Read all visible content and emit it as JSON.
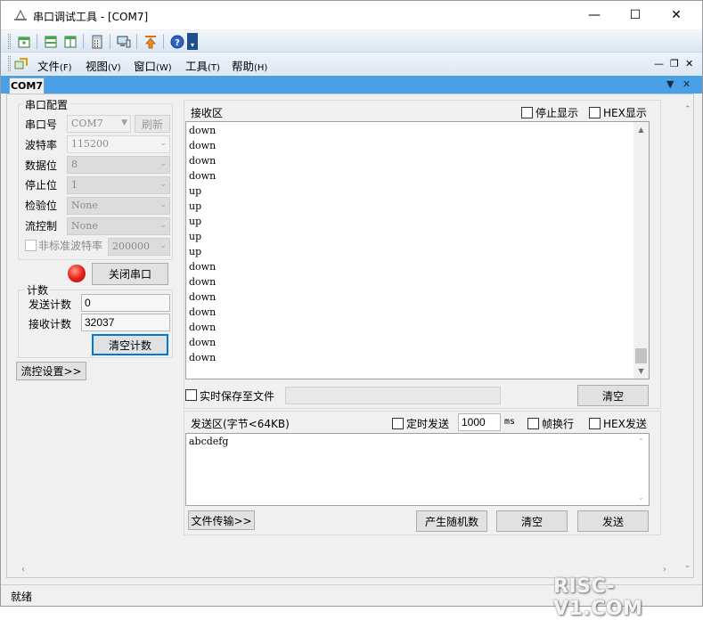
{
  "window": {
    "title": "串口调试工具 - [COM7]",
    "controls": {
      "minimize": "—",
      "maximize": "☐",
      "close": "✕"
    }
  },
  "menu": [
    {
      "label": "文件",
      "accel": "(F)"
    },
    {
      "label": "视图",
      "accel": "(V)"
    },
    {
      "label": "窗口",
      "accel": "(W)"
    },
    {
      "label": "工具",
      "accel": "(T)"
    },
    {
      "label": "帮助",
      "accel": "(H)"
    }
  ],
  "mdi_controls": {
    "min": "—",
    "restore": "❐",
    "close": "✕"
  },
  "tab": {
    "label": "COM7",
    "dropdown": "▼",
    "close": "✕"
  },
  "serial_config": {
    "title": "串口配置",
    "port_label": "串口号",
    "port_value": "COM7",
    "refresh_label": "刷新",
    "baud_label": "波特率",
    "baud_value": "115200",
    "databits_label": "数据位",
    "databits_value": "8",
    "stopbits_label": "停止位",
    "stopbits_value": "1",
    "parity_label": "检验位",
    "parity_value": "None",
    "flow_label": "流控制",
    "flow_value": "None",
    "nonstd_label": "非标准波特率",
    "nonstd_value": "200000",
    "close_port_label": "关闭串口",
    "led_color": "#e8231c"
  },
  "counter": {
    "title": "计数",
    "send_label": "发送计数",
    "send_value": "0",
    "recv_label": "接收计数",
    "recv_value": "32037",
    "clear_label": "清空计数"
  },
  "flow_settings_label": "流控设置>>",
  "receive": {
    "title": "接收区",
    "stop_display_label": "停止显示",
    "hex_display_label": "HEX显示",
    "lines": [
      "down",
      "down",
      "down",
      "down",
      "up",
      "up",
      "up",
      "up",
      "up",
      "down",
      "down",
      "down",
      "down",
      "down",
      "down",
      "down"
    ],
    "save_realtime_label": "实时保存至文件",
    "clear_label": "清空"
  },
  "send": {
    "title": "发送区(字节<64KB)",
    "timed_send_label": "定时发送",
    "interval_value": "1000",
    "interval_unit": "ms",
    "newline_label": "帧换行",
    "hex_send_label": "HEX发送",
    "content": "abcdefg",
    "file_transfer_label": "文件传输>>",
    "random_label": "产生随机数",
    "clear_label": "清空",
    "send_label": "发送"
  },
  "status": {
    "text": "就绪"
  },
  "watermark": "RISC-V1.COM"
}
